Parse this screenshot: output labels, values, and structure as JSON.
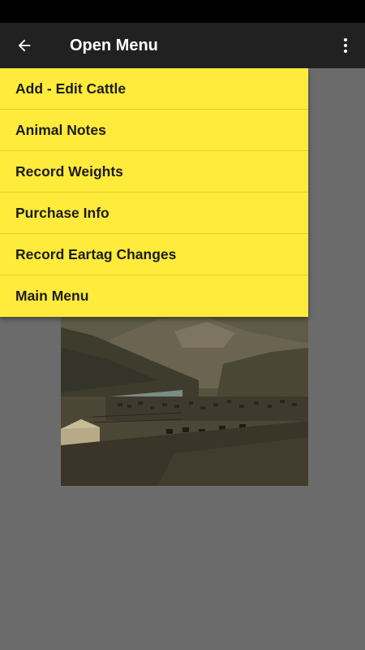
{
  "app_bar": {
    "title": "Open Menu",
    "back_icon": "arrow-left-icon",
    "overflow_icon": "more-vert-icon"
  },
  "menu": {
    "items": [
      {
        "label": "Add - Edit Cattle"
      },
      {
        "label": "Animal Notes"
      },
      {
        "label": "Record Weights"
      },
      {
        "label": "Purchase Info"
      },
      {
        "label": "Record Eartag Changes"
      },
      {
        "label": "Main Menu"
      }
    ]
  },
  "colors": {
    "menu_background": "#ffeb3b",
    "app_bar": "#212121",
    "screen_background": "#6b6b6b"
  }
}
